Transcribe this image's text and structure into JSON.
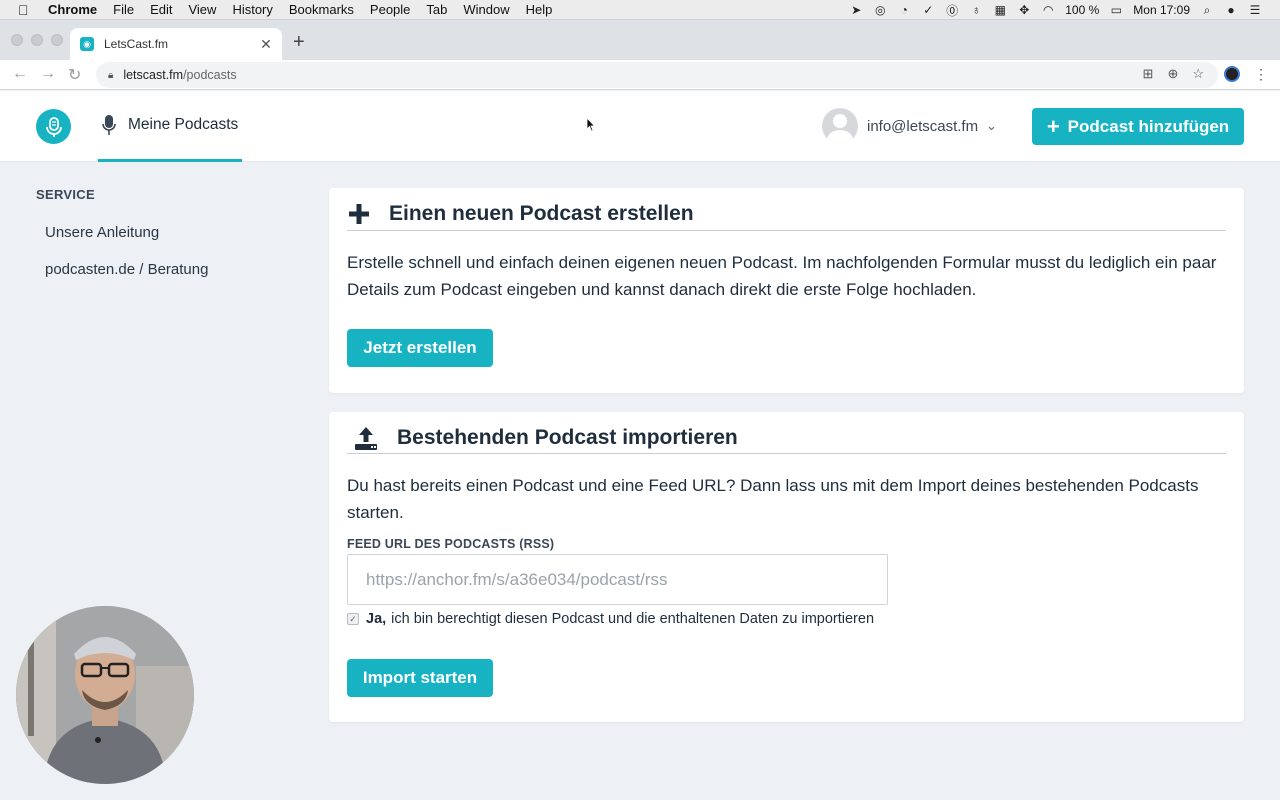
{
  "menubar": {
    "app": "Chrome",
    "items": [
      "File",
      "Edit",
      "View",
      "History",
      "Bookmarks",
      "People",
      "Tab",
      "Window",
      "Help"
    ],
    "battery": "100 %",
    "clock": "Mon 17:09"
  },
  "browser": {
    "tab_title": "LetsCast.fm",
    "url_host": "letscast.fm",
    "url_path": "/podcasts"
  },
  "header": {
    "nav_label": "Meine Podcasts",
    "user_email": "info@letscast.fm",
    "add_button": "Podcast hinzufügen"
  },
  "sidebar": {
    "heading": "SERVICE",
    "links": [
      "Unsere Anleitung",
      "podcasten.de / Beratung"
    ]
  },
  "create_card": {
    "title": "Einen neuen Podcast erstellen",
    "text": "Erstelle schnell und einfach deinen eigenen neuen Podcast. Im nachfolgenden Formular musst du lediglich ein paar Details zum Podcast eingeben und kannst danach direkt die erste Folge hochladen.",
    "button": "Jetzt erstellen"
  },
  "import_card": {
    "title": "Bestehenden Podcast importieren",
    "text": "Du hast bereits einen Podcast und eine Feed URL? Dann lass uns mit dem Import deines bestehenden Podcasts starten.",
    "field_label": "FEED URL DES PODCASTS (RSS)",
    "field_placeholder": "https://anchor.fm/s/a36e034/podcast/rss",
    "checkbox_bold": "Ja,",
    "checkbox_text": "ich bin berechtigt diesen Podcast und die enthaltenen Daten zu importieren",
    "checkbox_checked": true,
    "button": "Import starten"
  },
  "colors": {
    "accent": "#17b3c3",
    "page_bg": "#edf0f4",
    "text": "#1f2d3d"
  }
}
